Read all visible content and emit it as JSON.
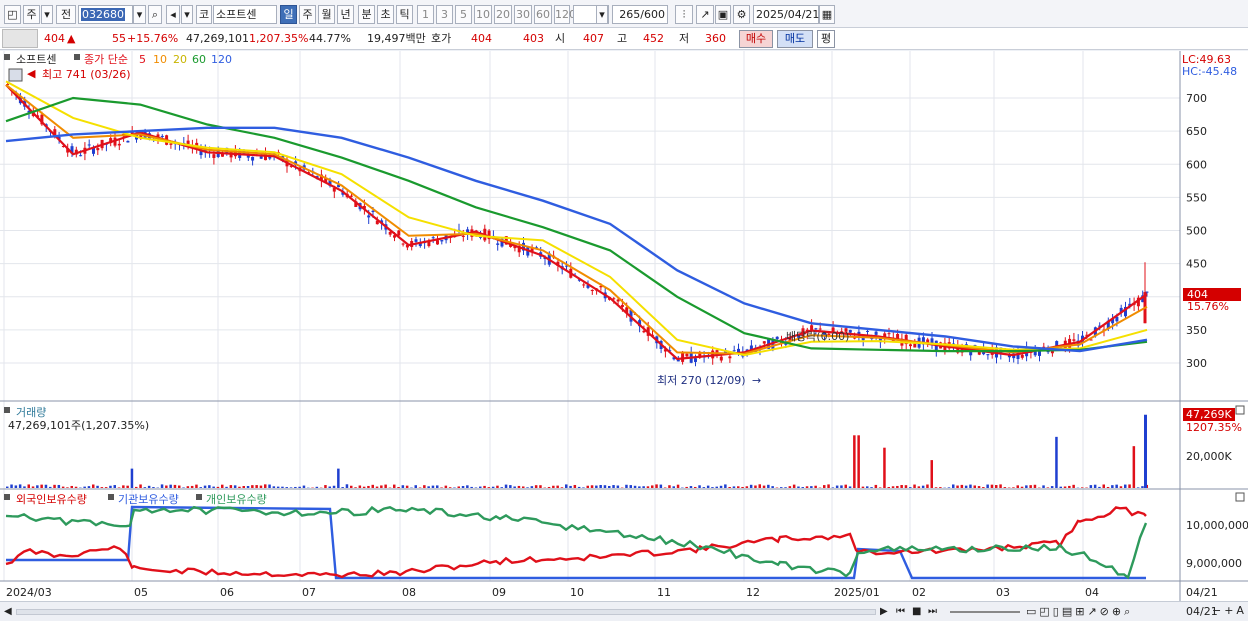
{
  "toolbar": {
    "period_label": "주",
    "prev_label": "전",
    "code": "032680",
    "market": "코",
    "stock_name": "소프트센",
    "tabs": [
      "일",
      "주",
      "월",
      "년",
      "분",
      "초",
      "틱"
    ],
    "active_tab": "일",
    "intervals": [
      "1",
      "3",
      "5",
      "10",
      "20",
      "30",
      "60",
      "120"
    ],
    "count": "265/600",
    "date": "2025/04/21"
  },
  "quote": {
    "price": "404",
    "arrow": "▲",
    "change": "55",
    "change_pct": "+15.76%",
    "volume": "47,269,101",
    "volume_pct": "1,207.35%",
    "turnover": "44.77%",
    "amount": "19,497백만",
    "hoga_label": "호가",
    "ask": "404",
    "bid": "403",
    "open_label": "시",
    "open": "407",
    "high_label": "고",
    "high": "452",
    "low_label": "저",
    "low": "360",
    "buy_label": "매수",
    "sell_label": "매도",
    "eval_label": "평"
  },
  "price_panel": {
    "name": "소프트센",
    "ma_title": "종가 단순",
    "ma_periods": [
      "5",
      "10",
      "20",
      "60",
      "120"
    ],
    "high_note": "최고 741 (03/26)",
    "low_note": "최저 270 (12/09)",
    "dividend_note": "배당락(0.00)",
    "lc": "LC:49.63",
    "hc": "HC:-45.48",
    "last_price": "404",
    "last_pct": "15.76%"
  },
  "volume_panel": {
    "title": "거래량",
    "value": "47,269,101주(1,207.35%)",
    "last_value": "47,269K",
    "last_pct": "1207.35%",
    "tick_20000": "20,000K"
  },
  "holding_panel": {
    "legend": [
      "외국인보유수량",
      "기관보유수량",
      "개인보유수량"
    ],
    "ticks": [
      "10,000,000",
      "9,000,000"
    ]
  },
  "x_axis_labels": [
    "2024/03",
    "05",
    "06",
    "07",
    "08",
    "09",
    "10",
    "11",
    "12",
    "2025/01",
    "02",
    "03",
    "04",
    "04/21"
  ],
  "colors": {
    "ma5": "#e0101a",
    "ma10": "#f08c00",
    "ma20": "#f5e000",
    "ma60": "#1a9a2e",
    "ma120": "#2f5de0",
    "up": "#e0101a",
    "down": "#1f3fd0",
    "foreign": "#e0101a",
    "institution": "#2f5de0",
    "individual": "#2e9a5c"
  },
  "chart_data": {
    "type": "line",
    "yaxis_ticks": [
      700,
      650,
      600,
      550,
      500,
      450,
      400,
      350,
      300
    ],
    "ylim": [
      270,
      741
    ],
    "x": [
      "2024/03",
      "05",
      "06",
      "07",
      "08",
      "09",
      "10",
      "11",
      "12",
      "2025/01",
      "02",
      "03",
      "04",
      "04/21"
    ],
    "series": [
      {
        "name": "5",
        "values": [
          720,
          615,
          648,
          618,
          612,
          560,
          478,
          498,
          462,
          398,
          306,
          316,
          349,
          340,
          325,
          312,
          332,
          404
        ]
      },
      {
        "name": "10",
        "values": [
          720,
          640,
          645,
          622,
          615,
          568,
          492,
          495,
          470,
          410,
          316,
          314,
          342,
          338,
          327,
          316,
          328,
          385
        ]
      },
      {
        "name": "20",
        "values": [
          725,
          670,
          640,
          625,
          618,
          585,
          520,
          492,
          485,
          430,
          335,
          312,
          332,
          333,
          328,
          320,
          322,
          350
        ]
      },
      {
        "name": "60",
        "values": [
          665,
          700,
          690,
          660,
          640,
          610,
          575,
          535,
          505,
          470,
          400,
          345,
          322,
          320,
          318,
          318,
          320,
          332
        ]
      },
      {
        "name": "120",
        "values": [
          635,
          645,
          650,
          655,
          655,
          640,
          610,
          575,
          545,
          510,
          440,
          390,
          360,
          350,
          340,
          325,
          318,
          335
        ]
      }
    ]
  }
}
